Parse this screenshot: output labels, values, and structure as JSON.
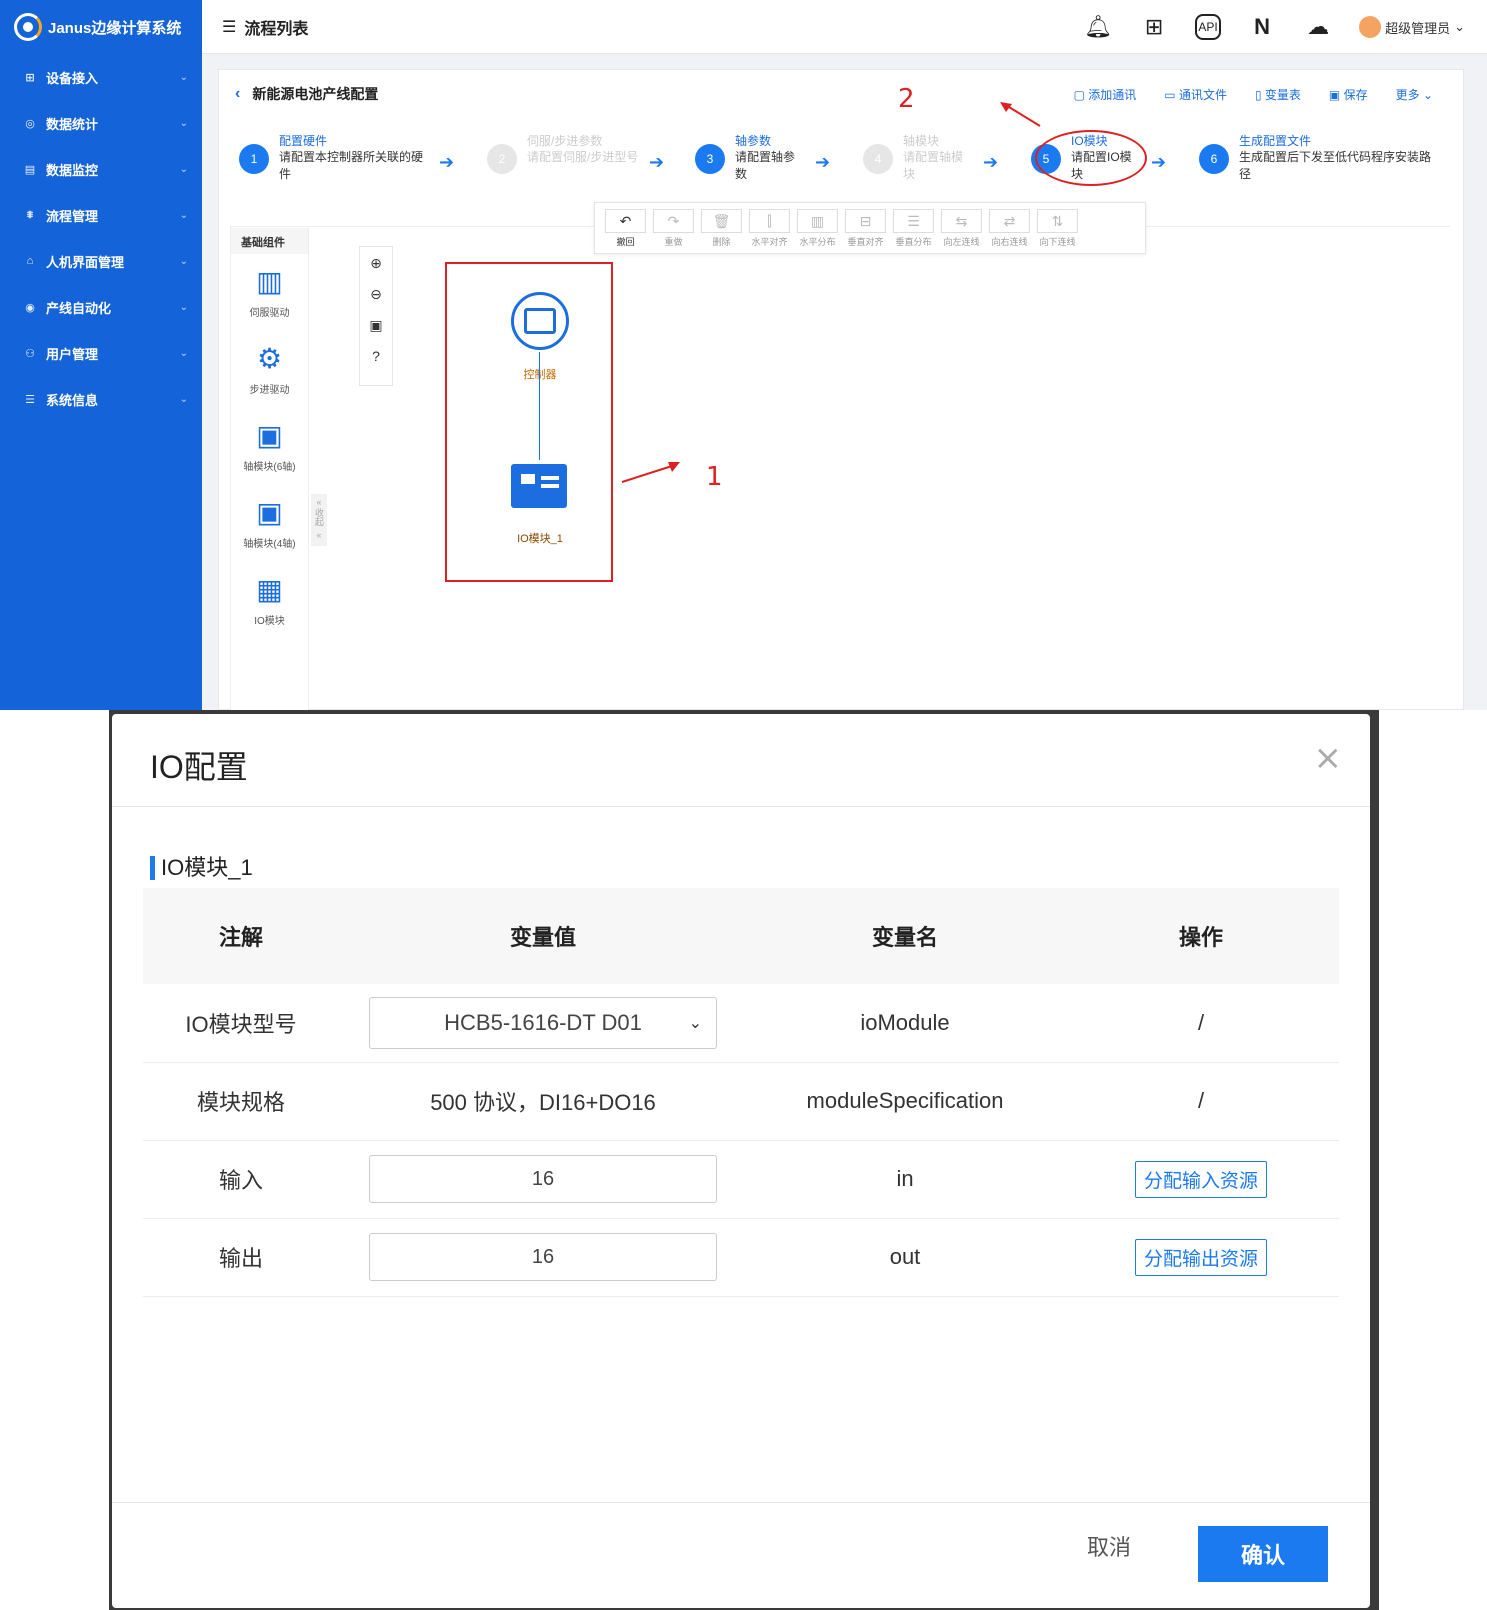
{
  "app": {
    "logo_text": "Janus边缘计算系统",
    "sidebar": [
      {
        "label": "设备接入",
        "icon": "devices-icon"
      },
      {
        "label": "数据统计",
        "icon": "stats-icon"
      },
      {
        "label": "数据监控",
        "icon": "monitor-icon"
      },
      {
        "label": "流程管理",
        "icon": "flow-icon"
      },
      {
        "label": "人机界面管理",
        "icon": "hmi-icon"
      },
      {
        "label": "产线自动化",
        "icon": "automation-icon"
      },
      {
        "label": "用户管理",
        "icon": "users-icon"
      },
      {
        "label": "系统信息",
        "icon": "settings-icon"
      }
    ],
    "topbar": {
      "title": "流程列表",
      "user": "超级管理员"
    },
    "panel": {
      "title": "新能源电池产线配置",
      "actions": [
        "添加通讯",
        "通讯文件",
        "变量表",
        "保存",
        "更多"
      ]
    },
    "steps": [
      {
        "num": "1",
        "title": "配置硬件",
        "desc": "请配置本控制器所关联的硬件",
        "disabled": false
      },
      {
        "num": "2",
        "title": "伺服/步进参数",
        "desc": "请配置伺服/步进型号",
        "disabled": true
      },
      {
        "num": "3",
        "title": "轴参数",
        "desc": "请配置轴参数",
        "disabled": false
      },
      {
        "num": "4",
        "title": "轴模块",
        "desc": "请配置轴模块",
        "disabled": true
      },
      {
        "num": "5",
        "title": "IO模块",
        "desc": "请配置IO模块",
        "disabled": false
      },
      {
        "num": "6",
        "title": "生成配置文件",
        "desc": "生成配置后下发至低代码程序安装路径",
        "disabled": false
      }
    ],
    "toolbar": [
      "撤回",
      "重做",
      "删除",
      "水平对齐",
      "水平分布",
      "垂直对齐",
      "垂直分布",
      "向左连线",
      "向右连线",
      "向下连线"
    ],
    "palette": {
      "title": "基础组件",
      "collapse": "收起",
      "items": [
        "伺服驱动",
        "步进驱动",
        "轴模块(6轴)",
        "轴模块(4轴)",
        "IO模块"
      ]
    },
    "canvas": {
      "controller_label": "控制器",
      "io_label": "IO模块_1"
    },
    "annotations": {
      "one": "1",
      "two": "2"
    }
  },
  "dialog": {
    "title": "IO配置",
    "section": "IO模块_1",
    "headers": [
      "注解",
      "变量值",
      "变量名",
      "操作"
    ],
    "rows": {
      "model": {
        "note": "IO模块型号",
        "value": "HCB5-1616-DT D01",
        "name": "ioModule",
        "op": "/"
      },
      "spec": {
        "note": "模块规格",
        "value": "500 协议，DI16+DO16",
        "name": "moduleSpecification",
        "op": "/"
      },
      "input": {
        "note": "输入",
        "value": "16",
        "name": "in",
        "op": "分配输入资源"
      },
      "output": {
        "note": "输出",
        "value": "16",
        "name": "out",
        "op": "分配输出资源"
      }
    },
    "cancel": "取消",
    "ok": "确认"
  }
}
